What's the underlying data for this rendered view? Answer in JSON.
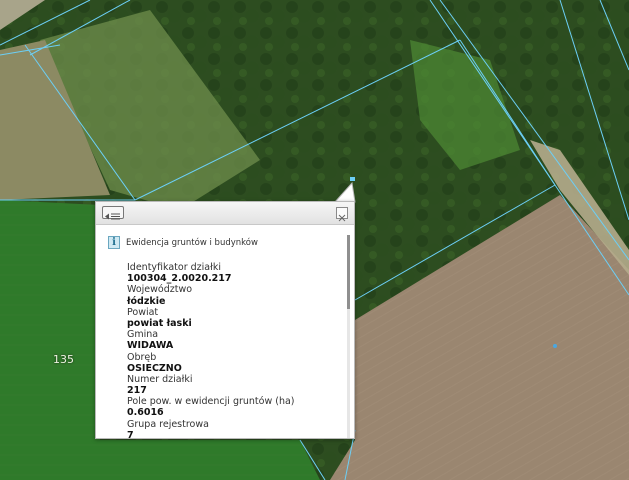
{
  "map": {
    "parcel_label": "135"
  },
  "popup": {
    "title": "Ewidencja gruntów i budynków",
    "fields": [
      {
        "label": "Identyfikator działki",
        "value": "100304_2.0020.217"
      },
      {
        "label": "Województwo",
        "value": "łódzkie"
      },
      {
        "label": "Powiat",
        "value": "powiat łaski"
      },
      {
        "label": "Gmina",
        "value": "WIDAWA"
      },
      {
        "label": "Obręb",
        "value": "OSIECZNO"
      },
      {
        "label": "Numer działki",
        "value": "217"
      },
      {
        "label": "Pole pow. w ewidencji gruntów (ha)",
        "value": "0.6016"
      },
      {
        "label": "Grupa rejestrowa",
        "value": "7"
      }
    ],
    "icons": {
      "list": "list-icon",
      "close": "close-icon",
      "info": "info-icon"
    }
  },
  "colors": {
    "parcel_boundary": "#6ccff6",
    "popup_background": "#ffffff"
  }
}
